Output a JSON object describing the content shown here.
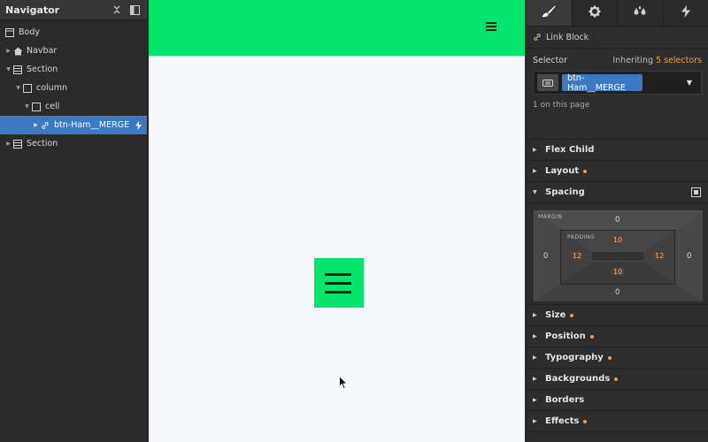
{
  "navigator": {
    "title": "Navigator",
    "tree": [
      {
        "label": "Body",
        "depth": 0,
        "icon": "body-icon",
        "caret": ""
      },
      {
        "label": "Navbar",
        "depth": 1,
        "icon": "home-icon",
        "caret": "collapsed"
      },
      {
        "label": "Section",
        "depth": 1,
        "icon": "section-icon",
        "caret": "expanded"
      },
      {
        "label": "column",
        "depth": 2,
        "icon": "square-icon",
        "caret": "expanded"
      },
      {
        "label": "cell",
        "depth": 3,
        "icon": "square-icon",
        "caret": "expanded"
      },
      {
        "label": "btn-Ham__MERGE",
        "depth": 4,
        "icon": "link-icon",
        "caret": "collapsed",
        "selected": true
      },
      {
        "label": "Section",
        "depth": 1,
        "icon": "section-icon",
        "caret": "collapsed"
      }
    ]
  },
  "style_panel": {
    "tabs": [
      "brush-icon",
      "gear-icon",
      "drops-icon",
      "bolt-icon"
    ],
    "element_type": "Link Block",
    "selector": {
      "label": "Selector",
      "inheriting_prefix": "Inheriting",
      "inheriting_count": "5 selectors",
      "chip": "btn-Ham__MERGE",
      "on_page": "1 on this page"
    },
    "sections_top": [
      {
        "label": "Flex Child",
        "dot": false,
        "caret": "collapsed"
      },
      {
        "label": "Layout",
        "dot": true,
        "caret": "collapsed"
      },
      {
        "label": "Spacing",
        "dot": false,
        "caret": "expanded"
      }
    ],
    "spacing": {
      "margin_label": "MARGIN",
      "padding_label": "PADDING",
      "margin": {
        "top": "0",
        "right": "0",
        "bottom": "0",
        "left": "0"
      },
      "padding": {
        "top": "10",
        "right": "12",
        "bottom": "10",
        "left": "12"
      }
    },
    "sections_bottom": [
      {
        "label": "Size",
        "dot": true
      },
      {
        "label": "Position",
        "dot": true
      },
      {
        "label": "Typography",
        "dot": true
      },
      {
        "label": "Backgrounds",
        "dot": true
      },
      {
        "label": "Borders",
        "dot": false
      },
      {
        "label": "Effects",
        "dot": true
      }
    ]
  },
  "colors": {
    "brand_green": "#05e46c",
    "selection_blue": "#3b79c3",
    "accent_orange": "#ef9c47"
  }
}
